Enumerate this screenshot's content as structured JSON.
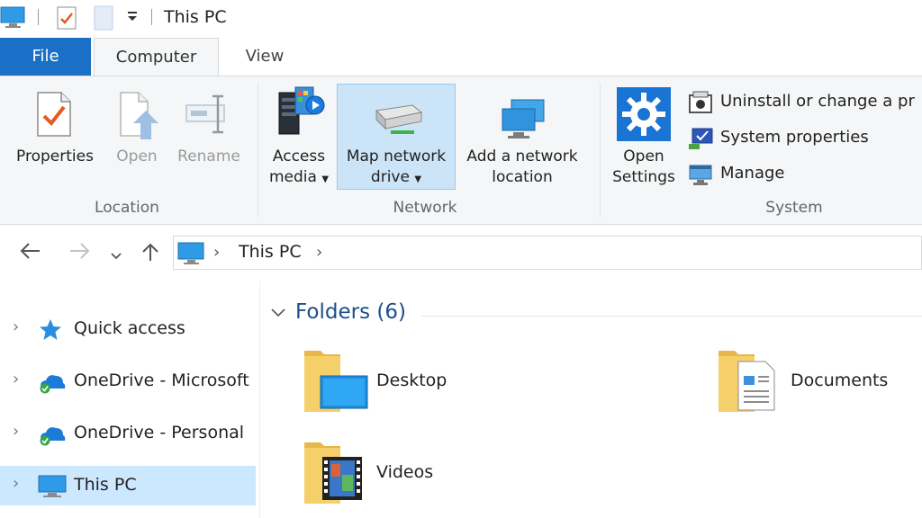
{
  "window": {
    "title": "This PC"
  },
  "tabs": {
    "file": "File",
    "computer": "Computer",
    "view": "View"
  },
  "ribbon": {
    "location": {
      "label": "Location",
      "properties": "Properties",
      "open": "Open",
      "rename": "Rename"
    },
    "network": {
      "label": "Network",
      "access_media_line1": "Access",
      "access_media_line2": "media",
      "map_drive_line1": "Map network",
      "map_drive_line2": "drive",
      "add_location_line1": "Add a network",
      "add_location_line2": "location"
    },
    "system": {
      "label": "System",
      "open_settings_line1": "Open",
      "open_settings_line2": "Settings",
      "uninstall": "Uninstall or change a pr",
      "system_properties": "System properties",
      "manage": "Manage"
    }
  },
  "address": {
    "path": "This PC"
  },
  "navpane": {
    "items": [
      {
        "label": "Quick access",
        "icon": "star-icon"
      },
      {
        "label": "OneDrive - Microsoft",
        "icon": "onedrive-icon"
      },
      {
        "label": "OneDrive - Personal",
        "icon": "onedrive-icon"
      },
      {
        "label": "This PC",
        "icon": "computer-icon",
        "selected": true
      }
    ]
  },
  "content": {
    "group_header": "Folders (6)",
    "folders": [
      {
        "label": "Desktop",
        "icon": "desktop-folder-icon"
      },
      {
        "label": "Documents",
        "icon": "documents-folder-icon"
      },
      {
        "label": "Videos",
        "icon": "videos-folder-icon"
      }
    ]
  },
  "colors": {
    "accent": "#1a6fc6",
    "selection": "#cce8ff",
    "group_header": "#1e4e8c"
  }
}
